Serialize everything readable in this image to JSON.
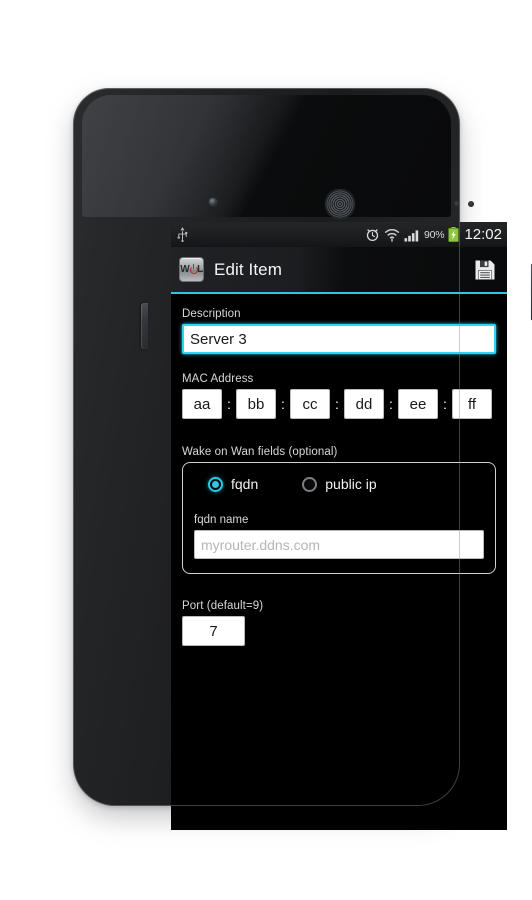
{
  "device": {
    "front_camera_icon": "camera-dot-icon",
    "earpiece_icon": "earpiece-speaker-icon",
    "power_key_name": "power-button",
    "volume_key_name": "volume-button"
  },
  "status_bar": {
    "usb_icon": "usb-icon",
    "alarm_icon": "alarm-clock-icon",
    "wifi_icon": "wifi-icon",
    "signal_icon": "cellular-signal-icon",
    "battery_percent": "90%",
    "battery_icon": "battery-charging-icon",
    "battery_color": "#8ec63f",
    "clock": "12:02"
  },
  "action_bar": {
    "app_icon": "wol-app-icon",
    "app_icon_text_left": "W",
    "app_icon_text_right": "L",
    "title": "Edit Item",
    "save_icon": "save-floppy-icon",
    "accent_color": "#2ec5e8"
  },
  "form": {
    "description": {
      "label": "Description",
      "value": "Server 3",
      "placeholder": "",
      "focus_color": "#2ad6f0"
    },
    "mac_address": {
      "label": "MAC Address",
      "separator": ":",
      "octets": [
        "aa",
        "bb",
        "cc",
        "dd",
        "ee",
        "ff"
      ]
    },
    "wake_on_wan": {
      "label": "Wake on Wan fields (optional)",
      "radios": [
        {
          "label": "fqdn",
          "checked": true
        },
        {
          "label": "public ip",
          "checked": false
        }
      ],
      "fqdn_name": {
        "label": "fqdn name",
        "value": "",
        "placeholder": "myrouter.ddns.com"
      }
    },
    "port": {
      "label": "Port (default=9)",
      "value": "7",
      "placeholder": ""
    }
  }
}
